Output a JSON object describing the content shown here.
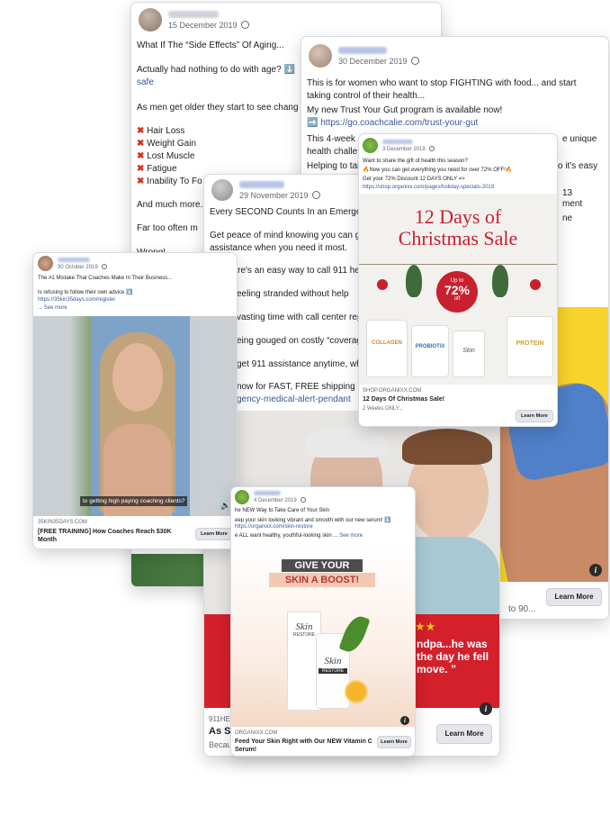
{
  "card_aging": {
    "date": "15 December 2019",
    "lines": [
      "What If The “Side Effects” Of Aging...",
      "Actually had nothing to do with age? ⬇️",
      "safe",
      "As men get older they start to see chang",
      "Hair Loss",
      "Weight Gain",
      "Lost Muscle",
      "Fatigue",
      "Inability To Fo",
      "And much more.",
      "Far too often m",
      "Wrong!"
    ]
  },
  "card_gut": {
    "date": "30 December 2019",
    "lines": [
      "This is for women who want to stop FIGHTING with food... and start",
      "taking control of their health...",
      "My new Trust Your Gut program is available now!",
      "https://go.coachcalie.com/trust-your-gut",
      "This 4-week",
      "health challe",
      "Helping to tal",
      "e unique",
      "so it's easy",
      "13",
      "ment",
      "ne"
    ],
    "link_arrow": "➡️",
    "footer_text": "to 90...",
    "learn_more": "Learn More"
  },
  "card_911": {
    "date": "29 November 2019",
    "lines": [
      "Every SECOND Counts In an Emergenc",
      "Get peace of mind knowing you can ge",
      "assistance when you need it most.",
      "here's an easy way to call 911 hel",
      "eeling stranded without help",
      "vasting time with call center rep",
      "eing gouged on costly “coverag",
      "get 911 assistance anytime, wh",
      "now for FAST, FREE shipping ⇒ h",
      "gency-medical-alert-pendant"
    ],
    "quote": "ndpa...he was\nthe day he fell\nmove. ”",
    "domain": "911HE",
    "title": "As S",
    "desc": "Becau",
    "learn_more": "Learn More"
  },
  "card_christmas": {
    "date": "3 December 2019",
    "lines": [
      "Want to share the gift of health this season?",
      "🔥Now you can get everything you need for over 72% OFF!🔥",
      "Get your 72% Discount 12 DAYS ONLY =>",
      "https://shop.organixx.com/pages/holiday-specials-2019"
    ],
    "headline": "12 Days of\nChristmas Sale",
    "badge_top": "Up to",
    "badge_pct": "72%",
    "badge_bottom": "off",
    "products": [
      "COLLAGEN",
      "PROBIOTIX",
      "Skin",
      "PROTEIN"
    ],
    "domain": "SHOP.ORGANIXX.COM",
    "title": "12 Days Of Christmas Sale!",
    "desc": "2 Weeks ONLY...",
    "learn_more": "Learn More"
  },
  "card_coaching": {
    "date": "30 October 2019",
    "lines": [
      "The #1 Mistake That Coaches Make In Their Business...",
      "Is refusing to follow their own advice ⬇️",
      "https://35kin35days.com/register",
      "... See more"
    ],
    "caption": "to getting high paying coaching clients?",
    "domain": "35KIN35DAYS.COM",
    "title": "[FREE TRAINING] How Coaches Reach $30K\nMonth",
    "learn_more": "Learn More"
  },
  "card_skin": {
    "date": "4 December 2019",
    "lines": [
      "he NEW Way to Take Care of Your Skin",
      "eep your skin looking vibrant and smooth with our new serum! ⬇️",
      "https://organixx.com/skin-restore",
      "e ALL want healthy, youthful-looking skin ... ",
      "See more"
    ],
    "banner_line1": "GIVE YOUR",
    "banner_line2": "SKIN A BOOST!",
    "product_name": "Skin",
    "product_sub": "RESTORE",
    "domain": "ORGANIXX.COM",
    "title": "Feed Your Skin Right with Our NEW Vitamin C\nSerum!",
    "learn_more": "Learn More"
  }
}
